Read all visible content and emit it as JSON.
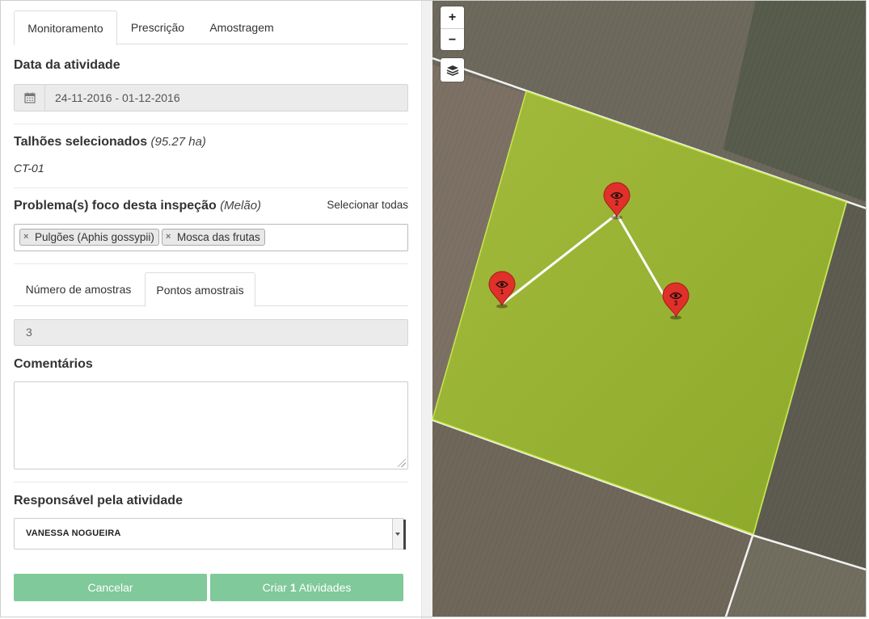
{
  "tabs": {
    "items": [
      {
        "label": "Monitoramento"
      },
      {
        "label": "Prescrição"
      },
      {
        "label": "Amostragem"
      }
    ]
  },
  "activity_date": {
    "label": "Data da atividade",
    "value": "24-11-2016 - 01-12-2016",
    "icon": "calendar-icon"
  },
  "plots": {
    "label": "Talhões selecionados",
    "area": "(95.27 ha)",
    "selected": "CT-01"
  },
  "problems": {
    "label": "Problema(s) foco desta inspeção",
    "crop": "(Melão)",
    "select_all": "Selecionar todas",
    "tags": [
      "Pulgões (Aphis gossypii)",
      "Mosca das frutas"
    ]
  },
  "sample_tabs": {
    "items": [
      {
        "label": "Número de amostras"
      },
      {
        "label": "Pontos amostrais"
      }
    ],
    "value": "3"
  },
  "comments": {
    "label": "Comentários",
    "value": ""
  },
  "responsible": {
    "label": "Responsável pela atividade",
    "value": "VANESSA NOGUEIRA"
  },
  "actions": {
    "cancel": "Cancelar",
    "create_prefix": "Criar ",
    "create_count": "1",
    "create_suffix": " Atividades"
  },
  "map": {
    "zoom_in": "+",
    "zoom_out": "−",
    "layers_icon": "layers-icon",
    "field_color": "#9cbc2c",
    "marker_color": "#e0302a",
    "markers": [
      {
        "label": "1"
      },
      {
        "label": "2"
      },
      {
        "label": "3"
      }
    ]
  },
  "colors": {
    "button": "#80c99a",
    "disabled_input": "#ebebeb"
  }
}
